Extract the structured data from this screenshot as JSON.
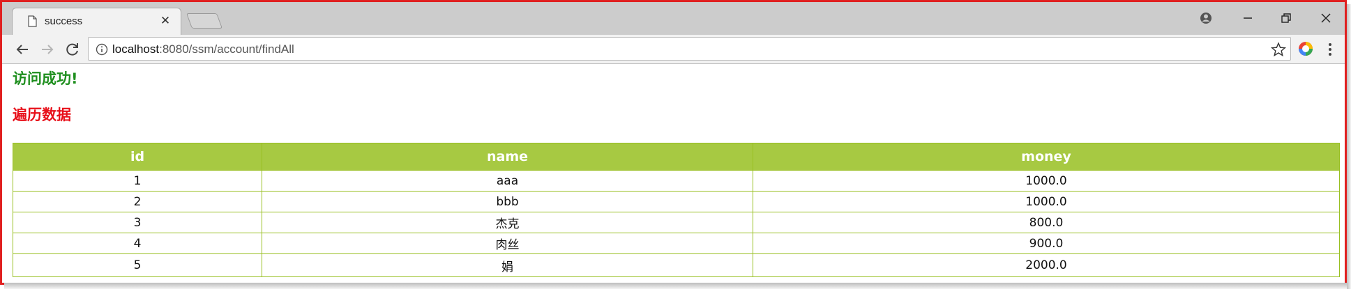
{
  "browser": {
    "tab_title": "success",
    "url_host": "localhost",
    "url_rest": ":8080/ssm/account/findAll"
  },
  "page": {
    "heading_success": "访问成功!",
    "heading_data": "遍历数据"
  },
  "table": {
    "headers": [
      "id",
      "name",
      "money"
    ],
    "rows": [
      [
        "1",
        "aaa",
        "1000.0"
      ],
      [
        "2",
        "bbb",
        "1000.0"
      ],
      [
        "3",
        "杰克",
        "800.0"
      ],
      [
        "4",
        "肉丝",
        "900.0"
      ],
      [
        "5",
        "娟",
        "2000.0"
      ]
    ],
    "header_color": "#a7c942",
    "border_color": "#98bf21"
  },
  "colors": {
    "success_heading": "#1f8f1f",
    "data_heading": "#e8101a",
    "window_border": "#e02020"
  },
  "icons": [
    "page-icon",
    "close-icon",
    "new-tab-icon",
    "profile-icon",
    "minimize-icon",
    "restore-icon",
    "window-close-icon",
    "back-icon",
    "forward-icon",
    "reload-icon",
    "info-icon",
    "bookmark-star-icon",
    "extension-icon",
    "menu-icon"
  ]
}
